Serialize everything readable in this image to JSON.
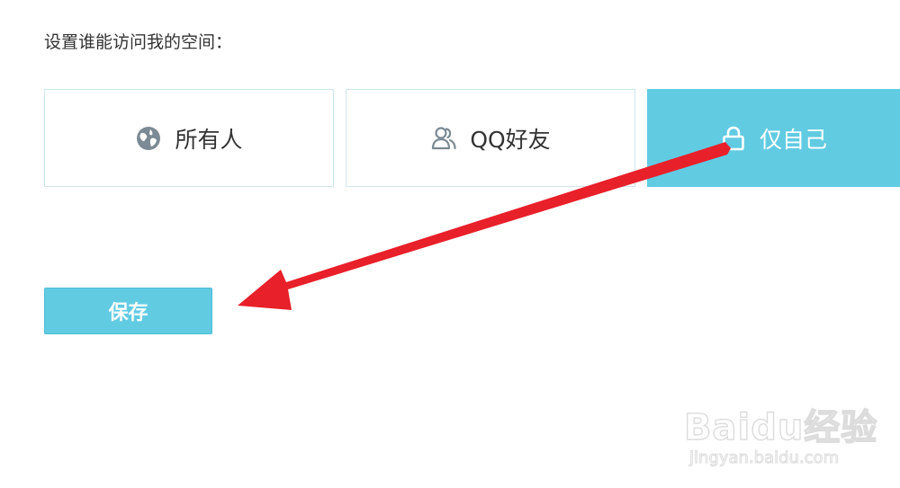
{
  "prompt_text": "设置谁能访问我的空间：",
  "visibility_options": [
    {
      "label": "所有人",
      "icon": "globe-icon",
      "selected": false
    },
    {
      "label": "QQ好友",
      "icon": "friends-icon",
      "selected": false
    },
    {
      "label": "仅自己",
      "icon": "lock-icon",
      "selected": true
    }
  ],
  "save_label": "保存",
  "annotation": {
    "arrow_color": "#e8202a",
    "description_icon": "red-arrow-icon"
  },
  "watermark": {
    "brand": "Baidu经验",
    "url": "jingyan.baidu.com"
  },
  "colors": {
    "accent": "#61cbe2",
    "border": "#cfe6ec",
    "text": "#333333"
  }
}
